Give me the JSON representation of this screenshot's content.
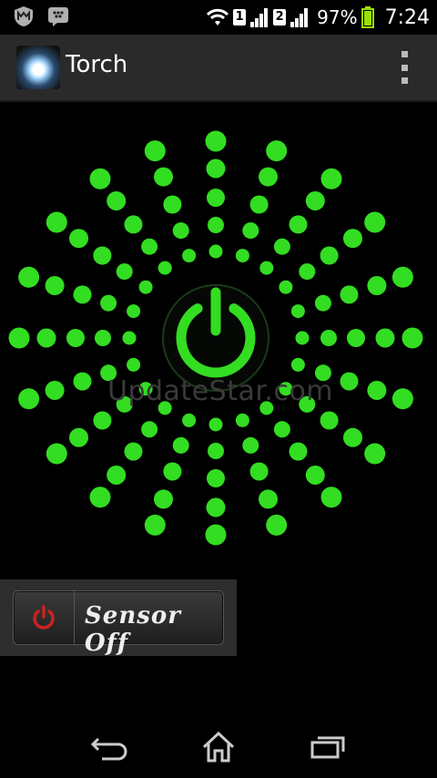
{
  "status_bar": {
    "left_icons": [
      "mcafee-icon",
      "bbm-icon"
    ],
    "sim1": "1",
    "sim2": "2",
    "battery_percent": "97%",
    "time": "7:24"
  },
  "action_bar": {
    "title": "Torch",
    "app_icon": "torch-app-icon",
    "overflow_icon": "overflow-menu-icon"
  },
  "main": {
    "power_icon": "power-icon",
    "accent_color": "#33dd22",
    "watermark": "UpdateStar.com"
  },
  "sensor": {
    "label": "Sensor Off",
    "icon": "power-icon",
    "icon_color": "#cc2222"
  },
  "nav_bar": {
    "back_icon": "back-icon",
    "home_icon": "home-icon",
    "recents_icon": "recent-apps-icon"
  }
}
